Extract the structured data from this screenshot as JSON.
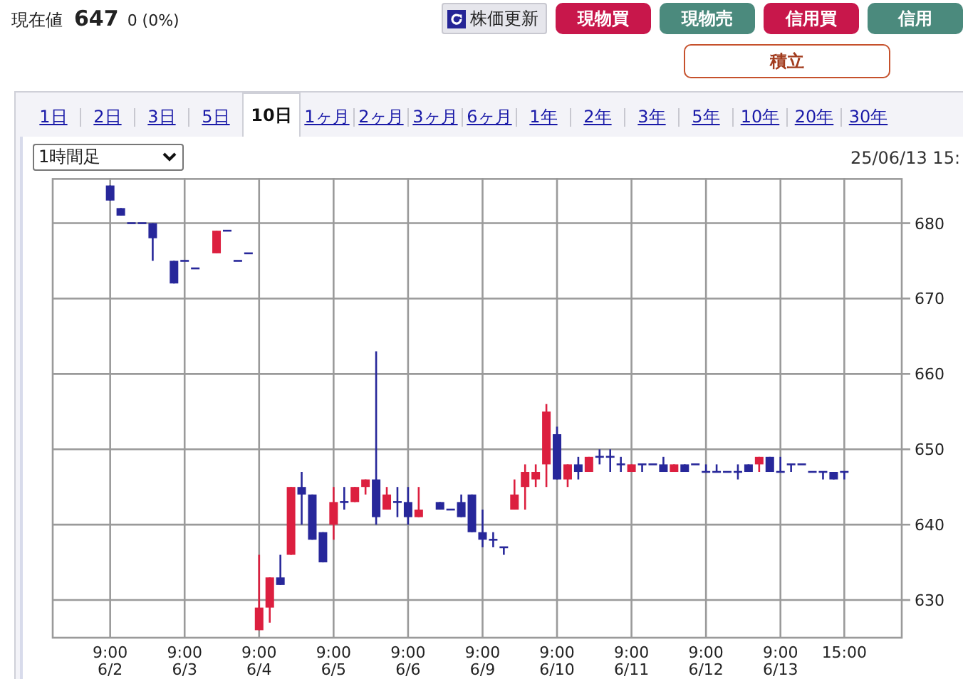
{
  "quote": {
    "label": "現在値",
    "price": "647",
    "change": "0 (0%)"
  },
  "refresh_button": {
    "label": "株価更新"
  },
  "trade_buttons": [
    {
      "label": "現物買",
      "kind": "buy"
    },
    {
      "label": "現物売",
      "kind": "sell"
    },
    {
      "label": "信用買",
      "kind": "buy"
    },
    {
      "label": "信用",
      "kind": "sell"
    }
  ],
  "accumulate_button": {
    "label": "積立"
  },
  "period_tabs": [
    {
      "label": "1日",
      "selected": false
    },
    {
      "label": "2日",
      "selected": false
    },
    {
      "label": "3日",
      "selected": false
    },
    {
      "label": "5日",
      "selected": false
    },
    {
      "label": "10日",
      "selected": true
    },
    {
      "label": "1ヶ月",
      "selected": false
    },
    {
      "label": "2ヶ月",
      "selected": false
    },
    {
      "label": "3ヶ月",
      "selected": false
    },
    {
      "label": "6ヶ月",
      "selected": false
    },
    {
      "label": "1年",
      "selected": false
    },
    {
      "label": "2年",
      "selected": false
    },
    {
      "label": "3年",
      "selected": false
    },
    {
      "label": "5年",
      "selected": false
    },
    {
      "label": "10年",
      "selected": false
    },
    {
      "label": "20年",
      "selected": false
    },
    {
      "label": "30年",
      "selected": false
    }
  ],
  "chart": {
    "interval_select": "1時間足",
    "timestamp": "25/06/13 15:",
    "chart_data": {
      "type": "candlestick",
      "grid": true,
      "ylim": [
        625,
        686
      ],
      "yticks": [
        630,
        640,
        650,
        660,
        670,
        680
      ],
      "categories": [
        "9:00\n6/2",
        null,
        null,
        null,
        null,
        null,
        null,
        "9:00\n6/3",
        null,
        null,
        null,
        null,
        null,
        null,
        "9:00\n6/4",
        null,
        null,
        null,
        null,
        null,
        null,
        "9:00\n6/5",
        null,
        null,
        null,
        null,
        null,
        null,
        "9:00\n6/6",
        null,
        null,
        null,
        null,
        null,
        null,
        "9:00\n6/9",
        null,
        null,
        null,
        null,
        null,
        null,
        "9:00\n6/10",
        null,
        null,
        null,
        null,
        null,
        null,
        "9:00\n6/11",
        null,
        null,
        null,
        null,
        null,
        null,
        "9:00\n6/12",
        null,
        null,
        null,
        null,
        null,
        null,
        "9:00\n6/13",
        null,
        null,
        null,
        null,
        null,
        "15:00"
      ],
      "ohlc": [
        [
          685,
          685,
          683,
          683
        ],
        [
          682,
          682,
          681,
          681
        ],
        [
          680,
          680,
          680,
          680
        ],
        [
          680,
          680,
          680,
          680
        ],
        [
          680,
          680,
          675,
          678
        ],
        null,
        [
          675,
          675,
          672,
          672
        ],
        [
          675,
          675,
          675,
          675
        ],
        [
          674,
          674,
          674,
          674
        ],
        null,
        [
          676,
          679,
          676,
          679
        ],
        [
          679,
          679,
          679,
          679
        ],
        [
          675,
          675,
          675,
          675
        ],
        [
          676,
          676,
          676,
          676
        ],
        [
          626,
          636,
          626,
          629
        ],
        [
          629,
          633,
          627,
          633
        ],
        [
          633,
          636,
          632,
          632
        ],
        [
          636,
          645,
          636,
          645
        ],
        [
          645,
          647,
          640,
          644
        ],
        [
          644,
          644,
          638,
          638
        ],
        [
          639,
          639,
          635,
          635
        ],
        [
          640,
          645,
          638,
          643
        ],
        [
          643,
          645,
          642,
          643
        ],
        [
          643,
          645,
          643,
          645
        ],
        [
          645,
          646,
          644,
          646
        ],
        [
          646,
          663,
          640,
          641
        ],
        [
          642,
          645,
          642,
          644
        ],
        [
          643,
          645,
          641,
          643
        ],
        [
          643,
          645,
          640,
          641
        ],
        [
          641,
          645,
          641,
          642
        ],
        null,
        [
          643,
          643,
          642,
          642
        ],
        [
          642,
          642,
          642,
          642
        ],
        [
          643,
          644,
          641,
          641
        ],
        [
          644,
          644,
          639,
          639
        ],
        [
          639,
          642,
          637,
          638
        ],
        [
          638,
          639,
          637,
          638
        ],
        [
          637,
          637,
          636,
          637
        ],
        [
          642,
          646,
          642,
          644
        ],
        [
          645,
          648,
          642,
          647
        ],
        [
          646,
          648,
          645,
          647
        ],
        [
          648,
          656,
          645,
          655
        ],
        [
          652,
          653,
          646,
          646
        ],
        [
          646,
          648,
          645,
          648
        ],
        [
          648,
          649,
          646,
          647
        ],
        [
          647,
          649,
          647,
          649
        ],
        [
          649,
          650,
          648,
          649
        ],
        [
          649,
          650,
          647,
          649
        ],
        [
          648,
          649,
          647,
          648
        ],
        [
          647,
          648,
          647,
          648
        ],
        [
          648,
          648,
          647,
          648
        ],
        [
          648,
          648,
          648,
          648
        ],
        [
          648,
          649,
          647,
          647
        ],
        [
          647,
          648,
          647,
          648
        ],
        [
          648,
          648,
          647,
          647
        ],
        [
          648,
          648,
          648,
          648
        ],
        [
          647,
          648,
          647,
          647
        ],
        [
          647,
          648,
          647,
          647
        ],
        [
          647,
          647,
          647,
          647
        ],
        [
          647,
          648,
          646,
          647
        ],
        [
          648,
          648,
          647,
          647
        ],
        [
          648,
          649,
          647,
          649
        ],
        [
          649,
          649,
          647,
          647
        ],
        [
          647,
          649,
          647,
          647
        ],
        [
          648,
          648,
          647,
          648
        ],
        [
          648,
          648,
          648,
          648
        ],
        [
          647,
          647,
          647,
          647
        ],
        [
          647,
          647,
          646,
          647
        ],
        [
          647,
          647,
          646,
          646
        ],
        [
          647,
          647,
          646,
          647
        ]
      ]
    }
  }
}
